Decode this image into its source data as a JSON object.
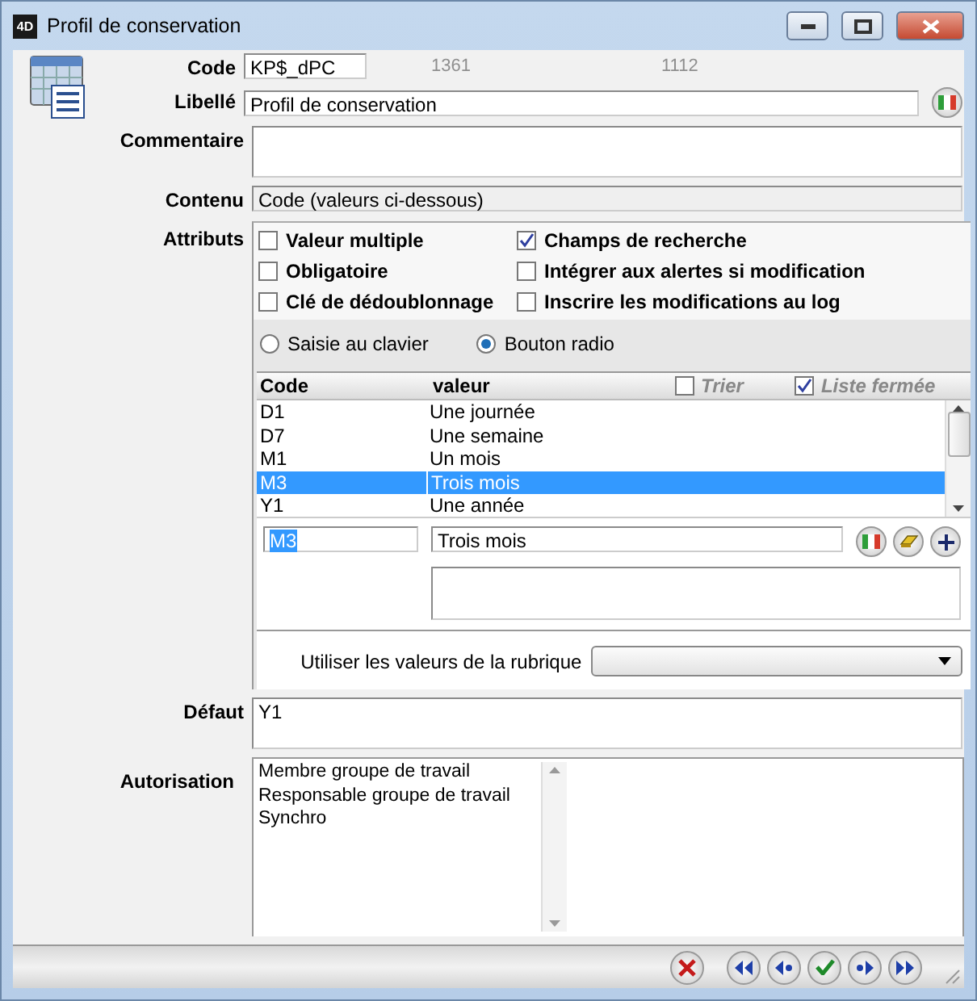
{
  "window": {
    "logo_text": "4D",
    "title": "Profil de conservation"
  },
  "form": {
    "code": {
      "label": "Code",
      "value": "KP$_dPC"
    },
    "ids": [
      "1361",
      "1112"
    ],
    "libelle": {
      "label": "Libellé",
      "value": "Profil de conservation"
    },
    "commentaire": {
      "label": "Commentaire"
    },
    "contenu": {
      "label": "Contenu",
      "value": "Code (valeurs ci-dessous)"
    }
  },
  "attributs": {
    "label": "Attributs",
    "options": [
      {
        "label": "Valeur multiple",
        "checked": false
      },
      {
        "label": "Champs de recherche",
        "checked": true
      },
      {
        "label": "Obligatoire",
        "checked": false
      },
      {
        "label": "Intégrer aux alertes si modification",
        "checked": false
      },
      {
        "label": "Clé de dédoublonnage",
        "checked": false
      },
      {
        "label": "Inscrire les modifications au log",
        "checked": false
      }
    ]
  },
  "input_modes": [
    {
      "label": "Saisie au clavier",
      "selected": false
    },
    {
      "label": "Bouton radio",
      "selected": true
    }
  ],
  "values_list": {
    "columns": [
      "Code",
      "valeur"
    ],
    "options": [
      {
        "label": "Trier",
        "checked": false
      },
      {
        "label": "Liste fermée",
        "checked": true
      }
    ],
    "rows": [
      {
        "code": "D1",
        "value": "Une journée",
        "selected": false
      },
      {
        "code": "D7",
        "value": "Une semaine",
        "selected": false
      },
      {
        "code": "M1",
        "value": "Un mois",
        "selected": false
      },
      {
        "code": "M3",
        "value": "Trois mois",
        "selected": true
      },
      {
        "code": "Y1",
        "value": "Une année",
        "selected": false
      }
    ]
  },
  "editor": {
    "code": "M3",
    "value": "Trois mois"
  },
  "source_field": {
    "label": "Utiliser les valeurs de la rubrique"
  },
  "defaut": {
    "label": "Défaut",
    "value": "Y1"
  },
  "autorisation": {
    "label": "Autorisation",
    "items": [
      "Membre groupe de travail",
      "Responsable groupe de travail",
      "Synchro"
    ]
  }
}
